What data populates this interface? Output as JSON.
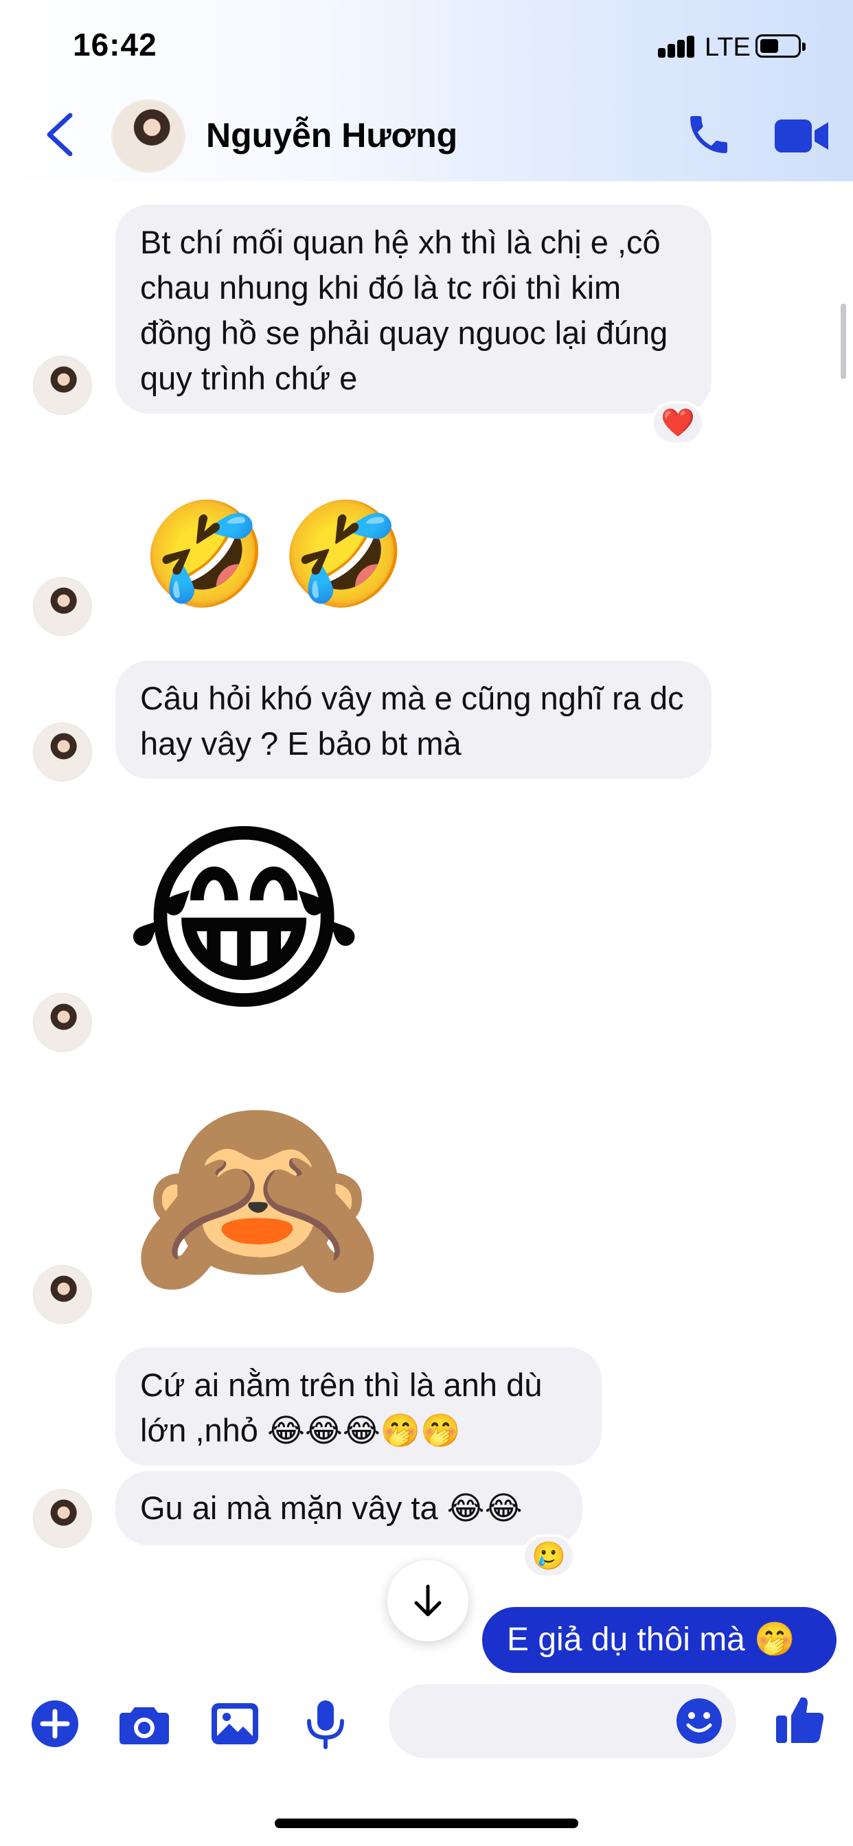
{
  "status_bar": {
    "time": "16:42",
    "network": "LTE"
  },
  "header": {
    "contact_name": "Nguyễn Hương"
  },
  "messages": [
    {
      "type": "text",
      "text": "Bt chí mối quan hệ xh thì là chị e ,cô chau nhung khi đó là tc rôi thì kim đồng hồ se phải quay nguoc lại đúng quy trình chứ e",
      "reaction": "❤️"
    },
    {
      "type": "emoji",
      "text": "🤣🤣"
    },
    {
      "type": "text",
      "text": "Câu hỏi khó vây mà e cũng nghĩ ra dc hay vây ? E bảo bt mà"
    },
    {
      "type": "emoji",
      "text": "😂"
    },
    {
      "type": "emoji",
      "text": "🙈"
    },
    {
      "type": "text",
      "text": "Cứ ai nằm trên thì là anh dù lớn ,nhỏ 😂😂😂🤭🤭"
    },
    {
      "type": "text",
      "text": "Gu ai mà mặn vây ta 😂😂",
      "reaction": "🥲"
    }
  ],
  "sent_message": {
    "text": "E giả dụ thôi mà 🤭"
  },
  "composer": {
    "placeholder": ""
  },
  "colors": {
    "accent": "#1a31cc",
    "icon_blue": "#1f3fd6",
    "bubble_gray": "#f0f0f5"
  }
}
